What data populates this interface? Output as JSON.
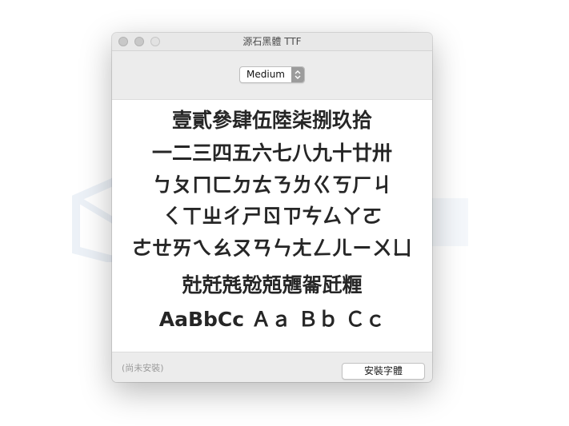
{
  "window": {
    "title": "源石黑體 TTF"
  },
  "toolbar": {
    "weight_selected": "Medium"
  },
  "preview": {
    "lines": [
      "壹貳參肆伍陸柒捌玖拾",
      "一二三四五六七八九十廿卅",
      "ㄅㄆㄇㄈㄉㄊㄋㄌㄍㄎㄏㄐ",
      "ㄑㄒㄓㄔㄕㄖㄗㄘㄙㄚㄛ",
      "ㄜㄝㄞㄟㄠㄡㄢㄣㄤㄥㄦㄧㄨㄩ",
      "兙兛兞兝兡兣嗧瓩糎",
      "AaBbCc Ａａ Ｂｂ Ｃｃ"
    ]
  },
  "footer": {
    "status": "(尚未安裝)",
    "install_label": "安裝字體"
  },
  "colors": {
    "window_bg": "#ececec",
    "preview_bg": "#ffffff",
    "text": "#262626"
  }
}
